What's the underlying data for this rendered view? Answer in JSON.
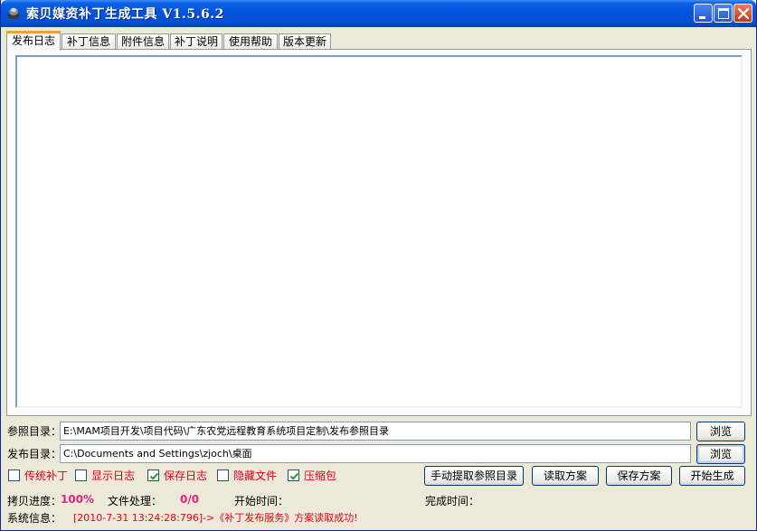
{
  "window": {
    "title": "索贝媒资补丁生成工具 V1.5.6.2"
  },
  "tabs": [
    {
      "label": "发布日志",
      "active": true
    },
    {
      "label": "补丁信息",
      "active": false
    },
    {
      "label": "附件信息",
      "active": false
    },
    {
      "label": "补丁说明",
      "active": false
    },
    {
      "label": "使用帮助",
      "active": false
    },
    {
      "label": "版本更新",
      "active": false
    }
  ],
  "log": {
    "text": ""
  },
  "paths": {
    "reference_label": "参照目录：",
    "reference_value": "E:\\MAM项目开发\\项目代码\\广东农党远程教育系统项目定制\\发布参照目录",
    "reference_browse": "浏览",
    "publish_label": "发布目录：",
    "publish_value": "C:\\Documents and Settings\\zjoch\\桌面",
    "publish_browse": "浏览"
  },
  "options": [
    {
      "label": "传统补丁",
      "checked": false
    },
    {
      "label": "显示日志",
      "checked": false
    },
    {
      "label": "保存日志",
      "checked": true
    },
    {
      "label": "隐藏文件",
      "checked": false
    },
    {
      "label": "压缩包",
      "checked": true
    }
  ],
  "actions": {
    "manual_extract": "手动提取参照目录",
    "load_scheme": "读取方案",
    "save_scheme": "保存方案",
    "start_generate": "开始生成"
  },
  "status": {
    "copy_progress_label": "拷贝进度：",
    "copy_progress_value": "100%",
    "file_processing_label": "文件处理：",
    "file_processing_value": "0/0",
    "start_time_label": "开始时间：",
    "start_time_value": "",
    "finish_time_label": "完成时间：",
    "finish_time_value": "",
    "system_info_label": "系统信息：",
    "system_info_value": "[2010-7-31 13:24:28:796]->《补丁发布服务》方案读取成功!"
  },
  "colors": {
    "title_bar": "#0453dc",
    "accent_red": "#e4001b",
    "accent_pink": "#e8247e",
    "tab_highlight": "#f0a034",
    "check_green": "#21a121"
  }
}
